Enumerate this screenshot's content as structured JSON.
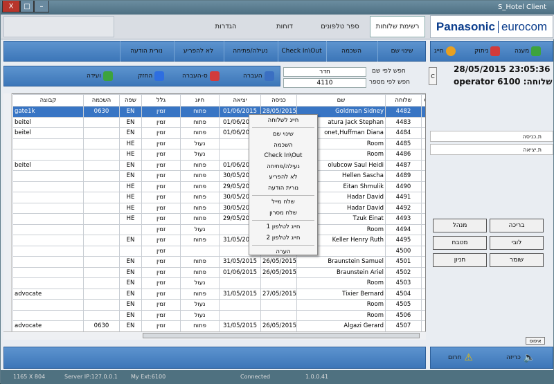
{
  "window": {
    "title": "S_Hotel Client",
    "minimize": "–",
    "maximize": "□",
    "close": "X"
  },
  "menu_tabs": [
    {
      "label": "רשימת שלוחות"
    },
    {
      "label": "ספר טלפונים"
    },
    {
      "label": "דוחות"
    },
    {
      "label": "הגדרות"
    }
  ],
  "logo": {
    "left": "Panasonic",
    "right": "eurocom"
  },
  "toolbar": [
    {
      "label": "שינוי שם"
    },
    {
      "label": "השכמה"
    },
    {
      "label": "Check In\\Out"
    },
    {
      "label": "נעילה/פתיחה"
    },
    {
      "label": "לא להפריע"
    },
    {
      "label": "נורית הודעה"
    }
  ],
  "call_bar": {
    "answer": "מענה",
    "hangup": "ניתוק",
    "dial": "חייג"
  },
  "actions": {
    "transfer": "העברה",
    "s_transfer": "ס-העברה",
    "hold": "החזק",
    "conference": "ועידה"
  },
  "search": {
    "by_name_label": "חפש לפי שם",
    "by_name_value": "חדר",
    "by_number_label": "חפש לפי מספר",
    "by_number_value": "4110",
    "c_button": "C"
  },
  "datetime": "28/05/2015 23:05:36",
  "operator": "שלוחה: operator 6100",
  "columns": [
    "ch",
    "שלוחה",
    "שם",
    "כניסה",
    "יציאה",
    "חיוג",
    "גלל",
    "שפה",
    "השכמה",
    "קבוצה"
  ],
  "rows": [
    {
      "ext": "4482",
      "name": "Goldman Sidney",
      "in": "28/05/2015",
      "out": "01/06/2015",
      "dial": "פתוח",
      "roll": "זמין",
      "lang": "EN",
      "wake": "0630",
      "group": "gate1k",
      "selected": true
    },
    {
      "ext": "4483",
      "name": "atura Jack Stephan",
      "in": "",
      "out": "01/06/2015",
      "dial": "פתוח",
      "roll": "זמין",
      "lang": "EN",
      "wake": "",
      "group": "beitel"
    },
    {
      "ext": "4484",
      "name": "onet,Huffman Diana",
      "in": "",
      "out": "01/06/2015",
      "dial": "פתוח",
      "roll": "זמין",
      "lang": "EN",
      "wake": "",
      "group": "beitel"
    },
    {
      "ext": "4485",
      "name": "Room",
      "in": "",
      "out": "",
      "dial": "נעול",
      "roll": "זמין",
      "lang": "HE",
      "wake": "",
      "group": ""
    },
    {
      "ext": "4486",
      "name": "Room",
      "in": "",
      "out": "",
      "dial": "נעול",
      "roll": "זמין",
      "lang": "HE",
      "wake": "",
      "group": ""
    },
    {
      "ext": "4487",
      "name": "olubcow Saul Heidi",
      "in": "",
      "out": "01/06/2015",
      "dial": "פתוח",
      "roll": "זמין",
      "lang": "EN",
      "wake": "",
      "group": "beitel"
    },
    {
      "ext": "4489",
      "name": "Hellen Sascha",
      "in": "",
      "out": "30/05/2015",
      "dial": "פתוח",
      "roll": "זמין",
      "lang": "EN",
      "wake": "",
      "group": ""
    },
    {
      "ext": "4490",
      "name": "Eitan Shmulik",
      "in": "",
      "out": "29/05/2015",
      "dial": "פתוח",
      "roll": "זמין",
      "lang": "HE",
      "wake": "",
      "group": ""
    },
    {
      "ext": "4491",
      "name": "Hadar David",
      "in": "",
      "out": "30/05/2015",
      "dial": "פתוח",
      "roll": "זמין",
      "lang": "HE",
      "wake": "",
      "group": ""
    },
    {
      "ext": "4492",
      "name": "Hadar David",
      "in": "",
      "out": "30/05/2015",
      "dial": "פתוח",
      "roll": "זמין",
      "lang": "HE",
      "wake": "",
      "group": ""
    },
    {
      "ext": "4493",
      "name": "Tzuk Einat",
      "in": "",
      "out": "29/05/2015",
      "dial": "פתוח",
      "roll": "זמין",
      "lang": "HE",
      "wake": "",
      "group": ""
    },
    {
      "ext": "4494",
      "name": "Room",
      "in": "",
      "out": "",
      "dial": "נעול",
      "roll": "זמין",
      "lang": "",
      "wake": "",
      "group": ""
    },
    {
      "ext": "4495",
      "name": "Keller Henry Ruth",
      "in": "",
      "out": "31/05/2015",
      "dial": "פתוח",
      "roll": "זמין",
      "lang": "EN",
      "wake": "",
      "group": ""
    },
    {
      "ext": "4500",
      "name": "",
      "in": "",
      "out": "",
      "dial": "",
      "roll": "זמין",
      "lang": "",
      "wake": "",
      "group": ""
    },
    {
      "ext": "4501",
      "name": "Braunstein Samuel",
      "in": "26/05/2015",
      "out": "31/05/2015",
      "dial": "פתוח",
      "roll": "זמין",
      "lang": "EN",
      "wake": "",
      "group": ""
    },
    {
      "ext": "4502",
      "name": "Braunstein Ariel",
      "in": "26/05/2015",
      "out": "01/06/2015",
      "dial": "פתוח",
      "roll": "זמין",
      "lang": "EN",
      "wake": "",
      "group": ""
    },
    {
      "ext": "4503",
      "name": "Room",
      "in": "",
      "out": "",
      "dial": "נעול",
      "roll": "זמין",
      "lang": "EN",
      "wake": "",
      "group": ""
    },
    {
      "ext": "4504",
      "name": "Tixier Bernard",
      "in": "27/05/2015",
      "out": "31/05/2015",
      "dial": "פתוח",
      "roll": "זמין",
      "lang": "EN",
      "wake": "",
      "group": "advocate"
    },
    {
      "ext": "4505",
      "name": "Room",
      "in": "",
      "out": "",
      "dial": "נעול",
      "roll": "זמין",
      "lang": "EN",
      "wake": "",
      "group": ""
    },
    {
      "ext": "4506",
      "name": "Room",
      "in": "",
      "out": "",
      "dial": "נעול",
      "roll": "זמין",
      "lang": "EN",
      "wake": "",
      "group": ""
    },
    {
      "ext": "4507",
      "name": "Algazi Gerard",
      "in": "26/05/2015",
      "out": "31/05/2015",
      "dial": "פתוח",
      "roll": "זמין",
      "lang": "EN",
      "wake": "0630",
      "group": "advocate"
    }
  ],
  "context_menu": [
    "חייג לשלוחה",
    "שינוי שם",
    "השכמה",
    "Check In\\Out",
    "נעילה/פתיחה",
    "לא להפריע",
    "נורית הודעה",
    "שלח מייל",
    "שלח מסרון",
    "חייג לטלפון 1",
    "חייג לטלפון 2",
    "הערה"
  ],
  "right_panel": {
    "checkin_label": "ת.כניסה",
    "checkout_label": "ת.יציאה",
    "speed_buttons": [
      "בריכה",
      "מנהל",
      "לובי",
      "מטבח",
      "שומר",
      "חניון"
    ],
    "reset": "איפוס"
  },
  "bottom": {
    "call": "כריזה",
    "emergency": "חרום"
  },
  "status": {
    "resolution": "1165 X 804",
    "server": "Server IP:127.0.0.1",
    "ext": "My Ext:6100",
    "state": "Connected",
    "version": "1.0.0.41"
  }
}
